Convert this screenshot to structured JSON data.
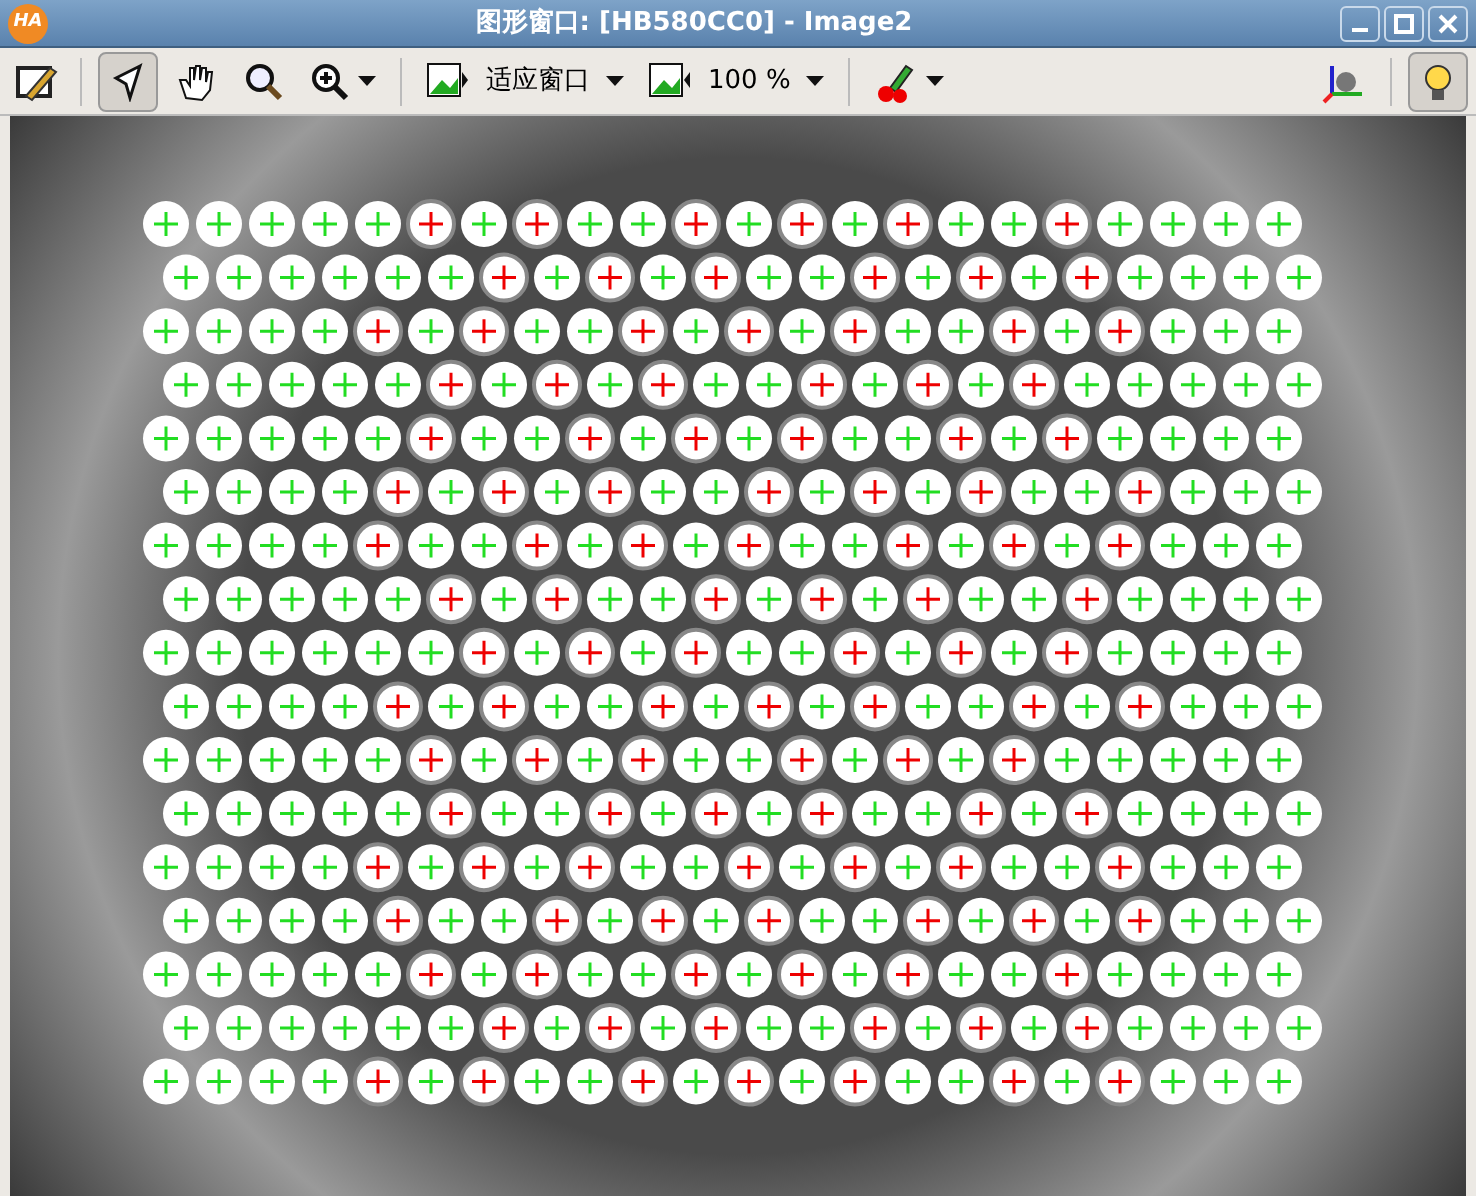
{
  "window": {
    "title": "图形窗口: [HB580CC0] - Image2",
    "app_badge": "HA"
  },
  "toolbar": {
    "fit_label": "适应窗口",
    "zoom_label": "100 %",
    "select_tool": {
      "selected": true
    },
    "light_toggle": {
      "selected": true
    }
  }
}
